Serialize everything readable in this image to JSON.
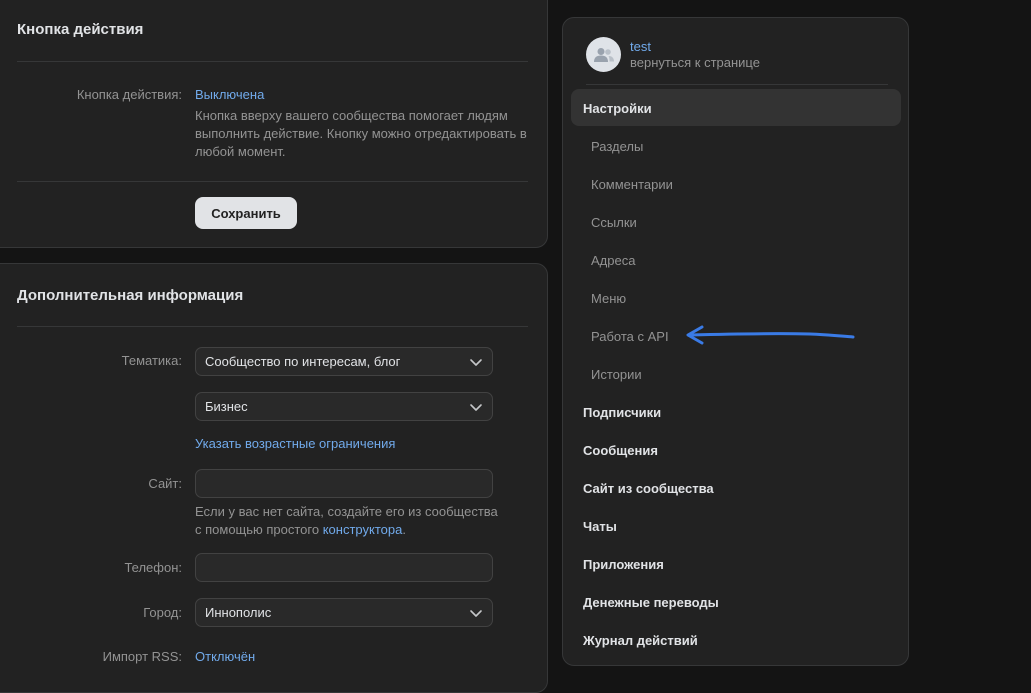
{
  "action_card": {
    "title": "Кнопка действия",
    "label": "Кнопка действия:",
    "value": "Выключена",
    "hint_line1": "Кнопка вверху вашего сообщества помогает людям",
    "hint_line2": "выполнить действие. Кнопку можно отредактировать в",
    "hint_line3": "любой момент.",
    "save_label": "Сохранить"
  },
  "info_card": {
    "title": "Дополнительная информация",
    "topic_label": "Тематика:",
    "topic_value": "Сообщество по интересам, блог",
    "subtopic_value": "Бизнес",
    "age_link": "Указать возрастные ограничения",
    "site_label": "Сайт:",
    "site_value": "",
    "site_hint_line1": "Если у вас нет сайта, создайте его из сообщества",
    "site_hint_prefix": "с помощью простого ",
    "site_hint_link": "конструктора",
    "site_hint_suffix": ".",
    "phone_label": "Телефон:",
    "phone_value": "",
    "city_label": "Город:",
    "city_value": "Иннополис",
    "rss_label": "Импорт RSS:",
    "rss_value": "Отключён"
  },
  "sidebar": {
    "name": "test",
    "back": "вернуться к странице",
    "active": "Настройки",
    "subitems": [
      "Разделы",
      "Комментарии",
      "Ссылки",
      "Адреса",
      "Меню",
      "Работа с API",
      "Истории"
    ],
    "items": [
      "Подписчики",
      "Сообщения",
      "Сайт из сообщества",
      "Чаты",
      "Приложения",
      "Денежные переводы",
      "Журнал действий"
    ]
  },
  "colors": {
    "accent": "#71aaeb",
    "annotation_arrow": "#3a7be6",
    "panel": "#222222",
    "background": "#141414"
  },
  "icons": {
    "avatar": "users-icon",
    "select": "chevron-down-icon",
    "annotation": "hand-drawn-arrow-left"
  }
}
